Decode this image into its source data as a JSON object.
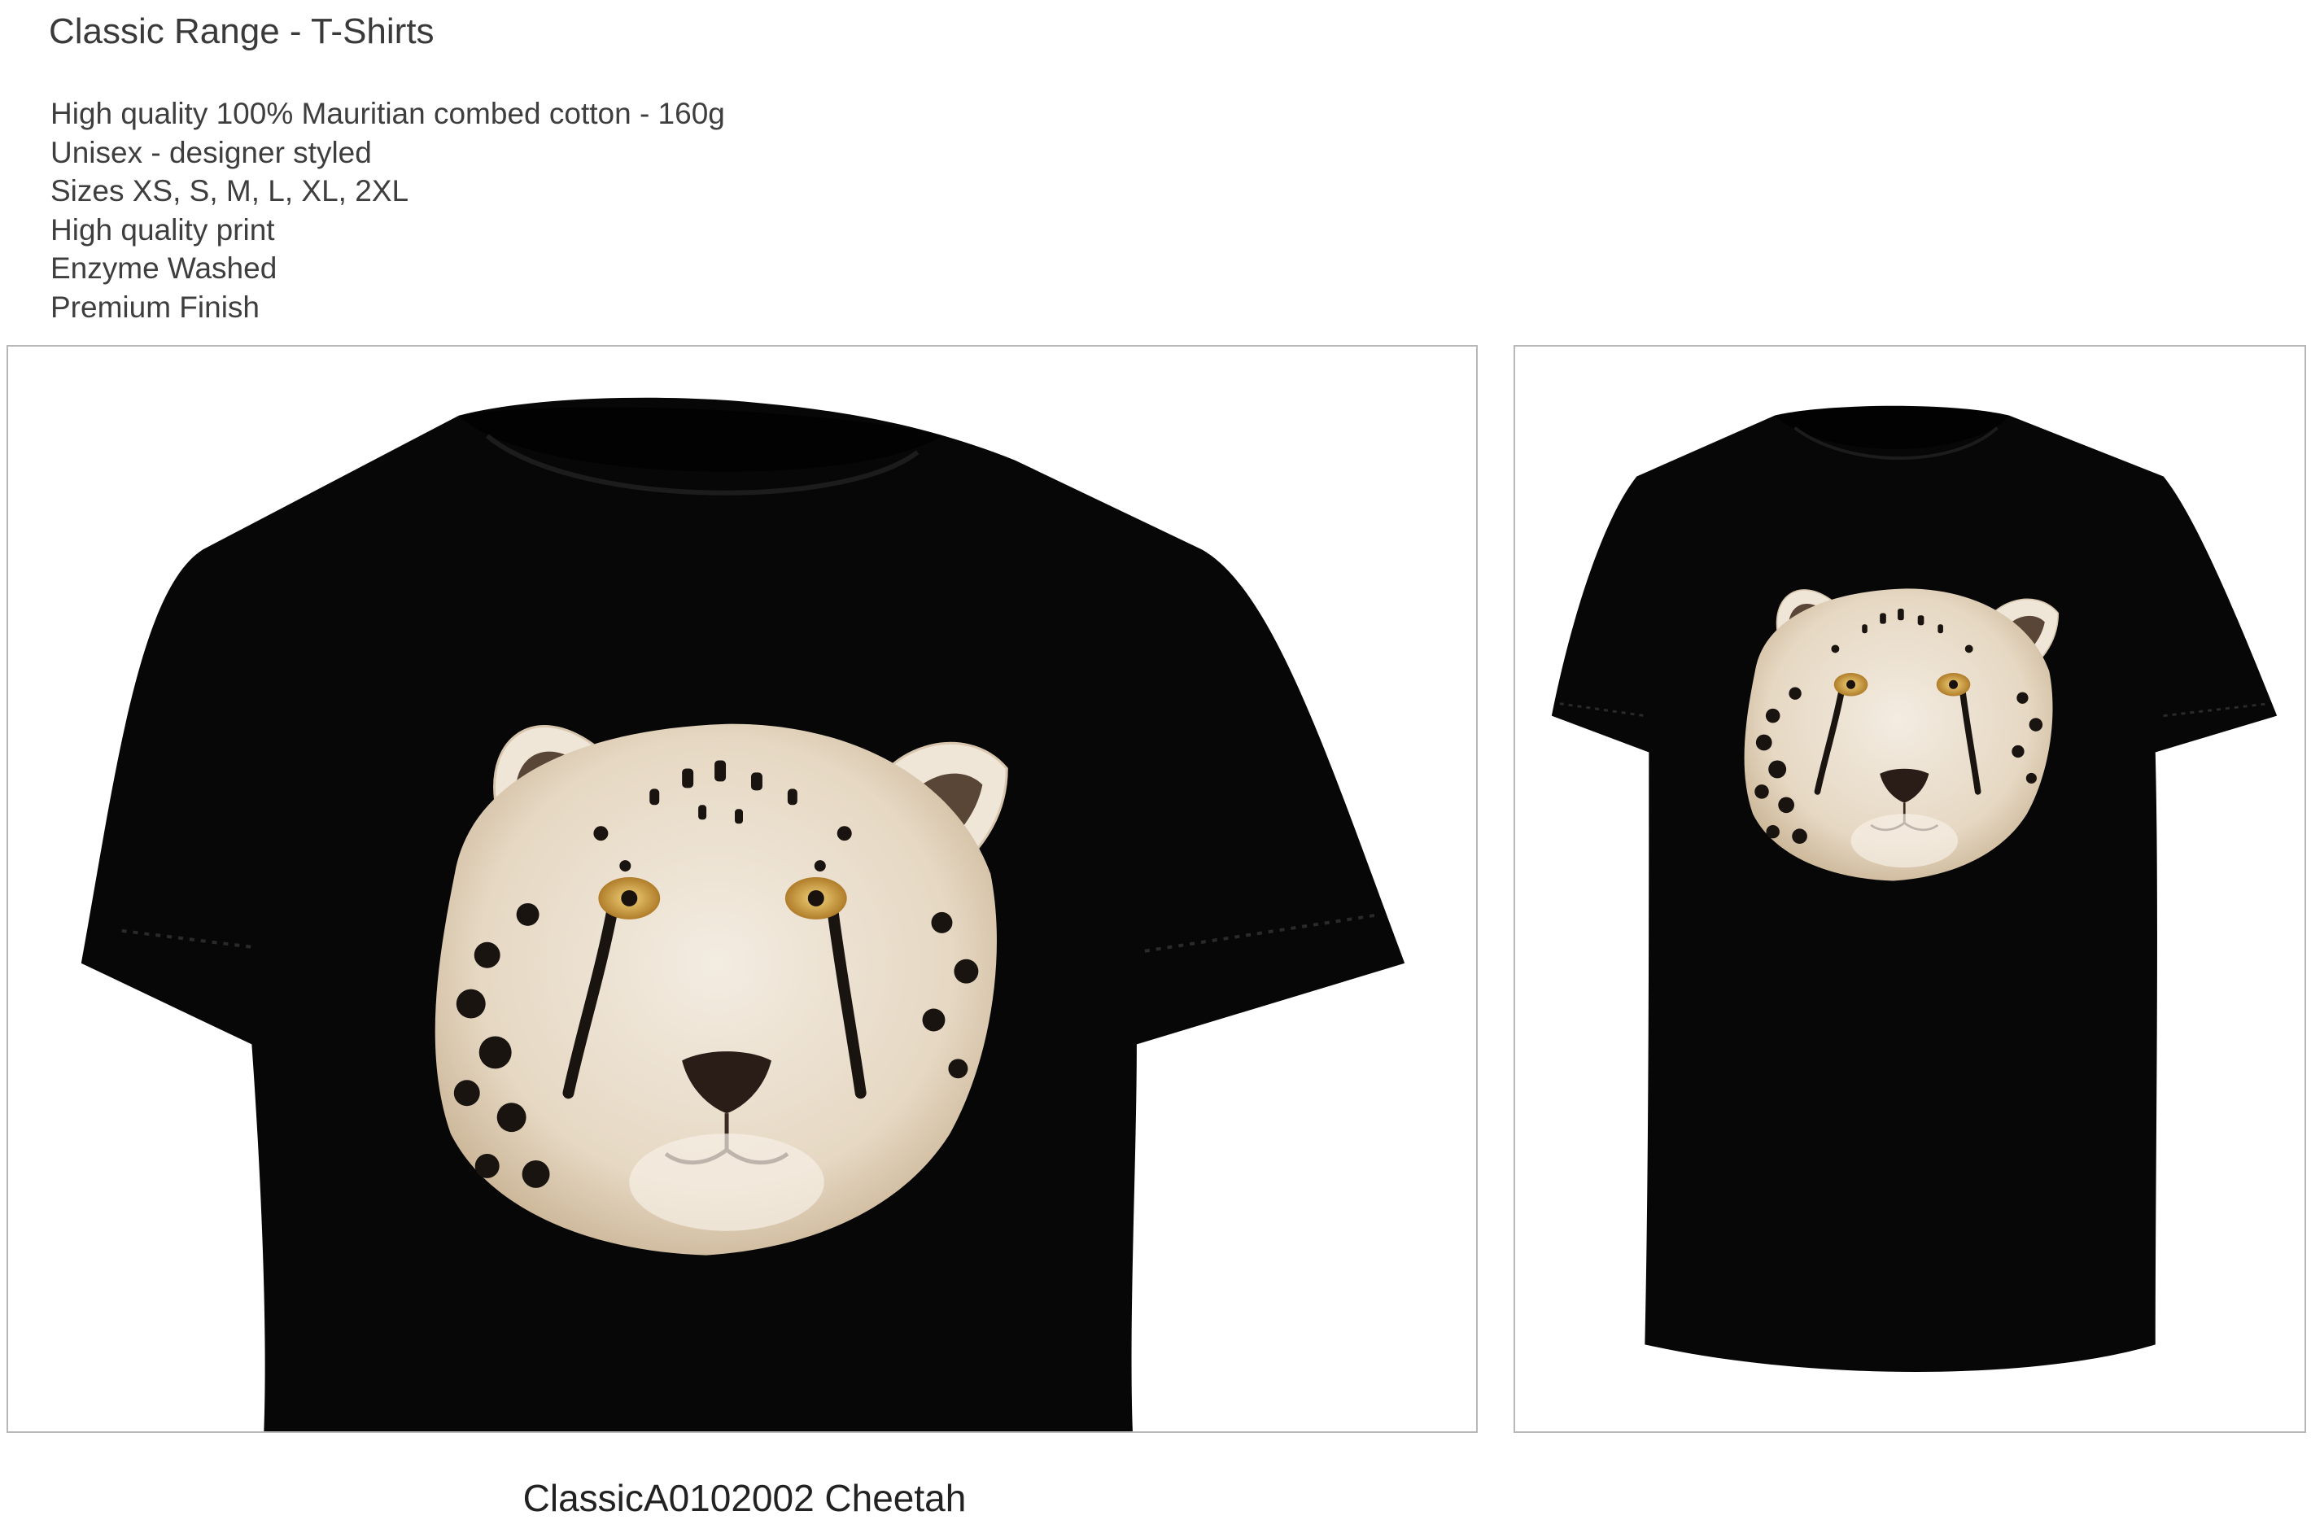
{
  "header": {
    "title": "Classic Range - T-Shirts"
  },
  "features": [
    "High quality 100% Mauritian combed cotton - 160g",
    "Unisex - designer styled",
    "Sizes XS, S, M, L, XL, 2XL",
    "High quality print",
    "Enzyme Washed",
    "Premium Finish"
  ],
  "product": {
    "caption": "ClassicA0102002 Cheetah",
    "shirt_color": "#070707",
    "print_colors": {
      "fur": "#efe6d8",
      "fur_shade": "#d8c7ae",
      "spot": "#1a1410",
      "eye": "#d9a94a",
      "nose": "#2a1d18"
    }
  },
  "images": [
    {
      "name": "close-up-view",
      "icon": "tshirt-closeup-image"
    },
    {
      "name": "full-view",
      "icon": "tshirt-full-image"
    }
  ]
}
